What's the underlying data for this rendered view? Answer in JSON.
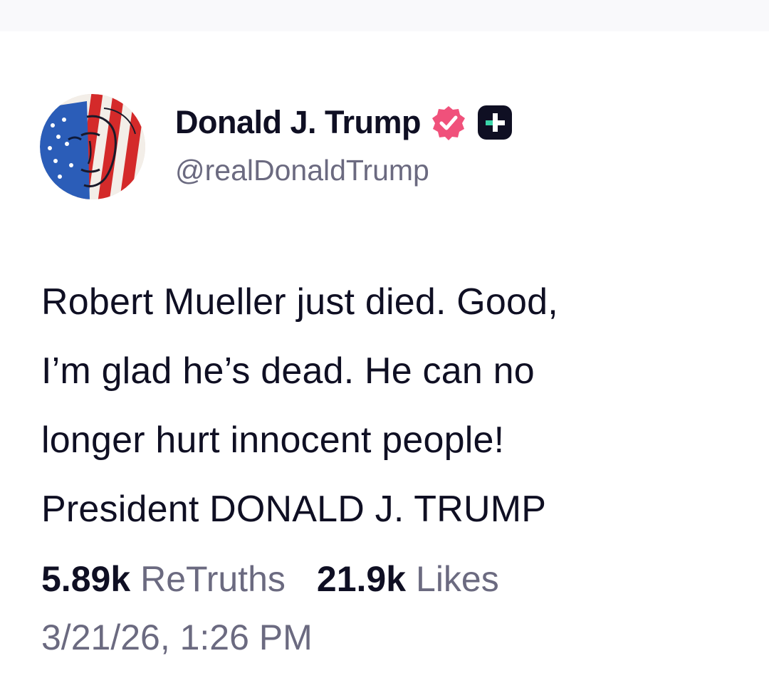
{
  "author": {
    "display_name": "Donald J. Trump",
    "handle": "@realDonaldTrump",
    "avatar": "flag-painted-portrait-avatar",
    "badges": [
      "verified-badge-icon",
      "truth-plus-icon"
    ]
  },
  "post": {
    "text": "Robert Mueller just died. Good,\nI’m glad he’s dead. He can no\nlonger hurt innocent people!\nPresident DONALD J. TRUMP"
  },
  "stats": {
    "retruths_count": "5.89k",
    "retruths_label": "ReTruths",
    "likes_count": "21.9k",
    "likes_label": "Likes"
  },
  "timestamp": "3/21/26, 1:26 PM",
  "colors": {
    "text_primary": "#0f0f23",
    "text_secondary": "#6b6a80",
    "verified_badge": "#f0517b",
    "plus_badge_bg": "#0f0f23",
    "plus_badge_accent": "#3ad4a8"
  }
}
